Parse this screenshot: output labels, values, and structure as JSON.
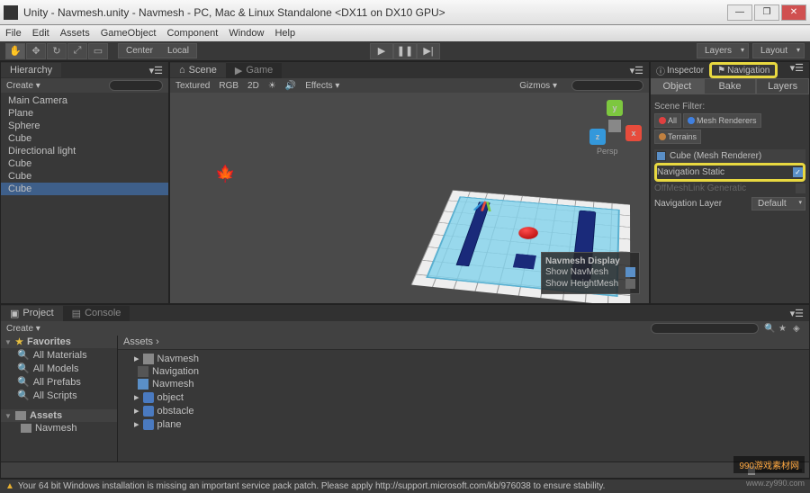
{
  "window": {
    "title": "Unity - Navmesh.unity - Navmesh - PC, Mac & Linux Standalone <DX11 on DX10 GPU>"
  },
  "menubar": [
    "File",
    "Edit",
    "Assets",
    "GameObject",
    "Component",
    "Window",
    "Help"
  ],
  "toolbar": {
    "pivot_center": "Center",
    "pivot_local": "Local",
    "layers": "Layers",
    "layout": "Layout"
  },
  "hierarchy": {
    "tab": "Hierarchy",
    "create": "Create",
    "items": [
      "Main Camera",
      "Plane",
      "Sphere",
      "Cube",
      "Directional light",
      "Cube",
      "Cube",
      "Cube"
    ]
  },
  "scene": {
    "tab_scene": "Scene",
    "tab_game": "Game",
    "shading": "Textured",
    "rgb": "RGB",
    "mode2d": "2D",
    "effects": "Effects",
    "gizmos": "Gizmos",
    "persp": "Persp",
    "navmesh_display": {
      "title": "Navmesh Display",
      "show_navmesh": "Show NavMesh",
      "show_heightmesh": "Show HeightMesh"
    }
  },
  "inspector": {
    "tab_inspector": "Inspector",
    "tab_navigation": "Navigation",
    "subtabs": [
      "Object",
      "Bake",
      "Layers"
    ],
    "scene_filter": "Scene Filter:",
    "filters": {
      "all": "All",
      "mesh": "Mesh Renderers",
      "terrain": "Terrains"
    },
    "object_name": "Cube (Mesh Renderer)",
    "nav_static": "Navigation Static",
    "offmesh": "OffMeshLink Generatic",
    "nav_layer": "Navigation Layer",
    "nav_layer_value": "Default"
  },
  "project": {
    "tab_project": "Project",
    "tab_console": "Console",
    "create": "Create",
    "favorites": "Favorites",
    "fav_items": [
      "All Materials",
      "All Models",
      "All Prefabs",
      "All Scripts"
    ],
    "assets_header": "Assets",
    "assets_folder": "Navmesh",
    "content_path": "Assets ›",
    "content_items": [
      {
        "name": "Navmesh",
        "type": "folder"
      },
      {
        "name": "Navigation",
        "type": "scene"
      },
      {
        "name": "Navmesh",
        "type": "nav"
      },
      {
        "name": "object",
        "type": "prefab"
      },
      {
        "name": "obstacle",
        "type": "prefab"
      },
      {
        "name": "plane",
        "type": "prefab"
      }
    ]
  },
  "statusbar": {
    "message": "Your 64 bit Windows installation is missing an important service pack patch. Please apply http://support.microsoft.com/kb/976038 to ensure stability."
  },
  "watermark": {
    "line1": "990游戏素材网",
    "line2": "www.zy990.com"
  }
}
